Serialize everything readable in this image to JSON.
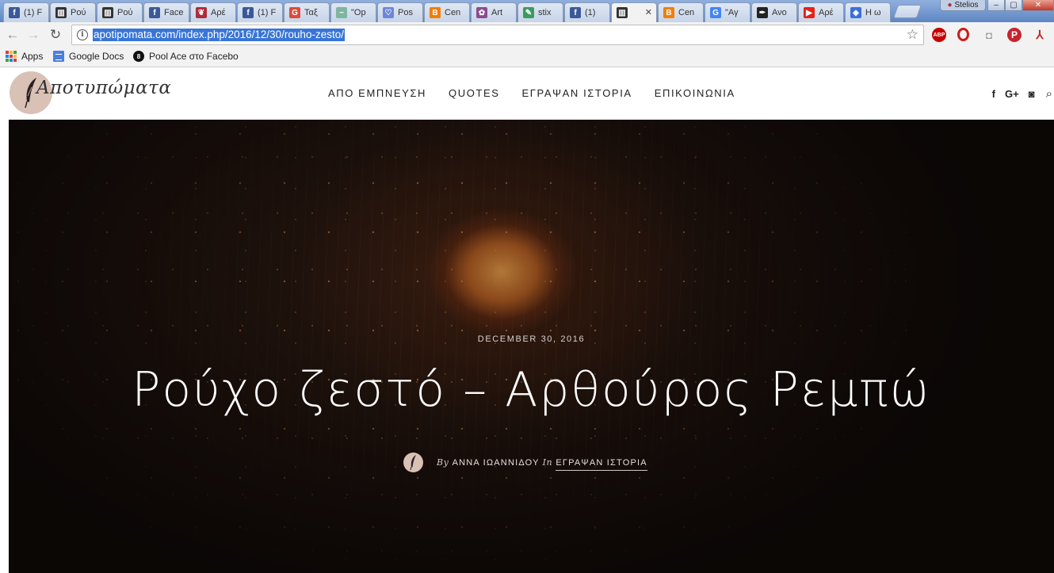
{
  "browser": {
    "tabs": [
      {
        "title": "(1) F",
        "favicon": "facebook-icon",
        "color": "#3b5998",
        "glyph": "f"
      },
      {
        "title": "Ρού",
        "favicon": "site-icon",
        "color": "#333333",
        "glyph": "▥"
      },
      {
        "title": "Ρού",
        "favicon": "site-icon",
        "color": "#333333",
        "glyph": "▥"
      },
      {
        "title": "Face",
        "favicon": "facebook-icon",
        "color": "#3b5998",
        "glyph": "f"
      },
      {
        "title": "Αρέ",
        "favicon": "quill-icon",
        "color": "#b02c3a",
        "glyph": "❦"
      },
      {
        "title": "(1) F",
        "favicon": "facebook-icon",
        "color": "#3b5998",
        "glyph": "f"
      },
      {
        "title": "Ταξ",
        "favicon": "google-plus-icon",
        "color": "#dd4b39",
        "glyph": "G"
      },
      {
        "title": "\"Op",
        "favicon": "wave-icon",
        "color": "#7fb5a0",
        "glyph": "~"
      },
      {
        "title": "Pos",
        "favicon": "heart-icon",
        "color": "#6c86d8",
        "glyph": "♡"
      },
      {
        "title": "Cen",
        "favicon": "blogger-icon",
        "color": "#f57d00",
        "glyph": "B"
      },
      {
        "title": "Art",
        "favicon": "art-icon",
        "color": "#8e4a8e",
        "glyph": "✿"
      },
      {
        "title": "stix",
        "favicon": "feather-icon",
        "color": "#3a9b5c",
        "glyph": "✎"
      },
      {
        "title": "(1) ",
        "favicon": "facebook-icon",
        "color": "#3b5998",
        "glyph": "f"
      },
      {
        "title": "",
        "favicon": "site-icon",
        "color": "#333333",
        "glyph": "▥",
        "active": true
      },
      {
        "title": "Cen",
        "favicon": "blogger-icon",
        "color": "#f57d00",
        "glyph": "B"
      },
      {
        "title": "\"Αγ",
        "favicon": "google-icon",
        "color": "#4285f4",
        "glyph": "G"
      },
      {
        "title": "Ανο",
        "favicon": "ink-icon",
        "color": "#222222",
        "glyph": "✒"
      },
      {
        "title": "Αρέ",
        "favicon": "youtube-icon",
        "color": "#e62117",
        "glyph": "▶"
      },
      {
        "title": "Η ω",
        "favicon": "shield-icon",
        "color": "#3a6fd8",
        "glyph": "◈"
      }
    ],
    "user_name": "Stelios",
    "url": "apotipomata.com/index.php/2016/12/30/rouho-zesto/",
    "bookmarks": [
      {
        "label": "Apps",
        "icon": "apps-grid-icon"
      },
      {
        "label": "Google Docs",
        "icon": "google-docs-icon"
      },
      {
        "label": "Pool Ace στο Facebo",
        "icon": "pool-ball-icon"
      }
    ],
    "extensions": [
      "adblock-plus-icon",
      "opera-icon",
      "camera-icon",
      "pinterest-icon",
      "pdf-icon"
    ]
  },
  "site": {
    "logo_text": "Αποτυπώματα",
    "nav": [
      "ΑΠΟ ΕΜΠΝΕΥΣΗ",
      "QUOTES",
      "ΕΓΡΑΨΑΝ ΙΣΤΟΡΙΑ",
      "ΕΠΙΚΟΙΝΩΝΙΑ"
    ],
    "social": {
      "facebook": "f",
      "googleplus": "G+",
      "instagram": "◙",
      "search": "⌕"
    },
    "accent_color": "#d9c1b6"
  },
  "post": {
    "date": "DECEMBER 30, 2016",
    "title": "Ρούχο ζεστό – Αρθούρος Ρεμπώ",
    "by_label": "By",
    "author": "ΑΝΝΑ ΙΩΑΝΝΙΔΟΥ",
    "in_label": "In",
    "category": "ΕΓΡΑΨΑΝ ΙΣΤΟΡΙΑ"
  }
}
